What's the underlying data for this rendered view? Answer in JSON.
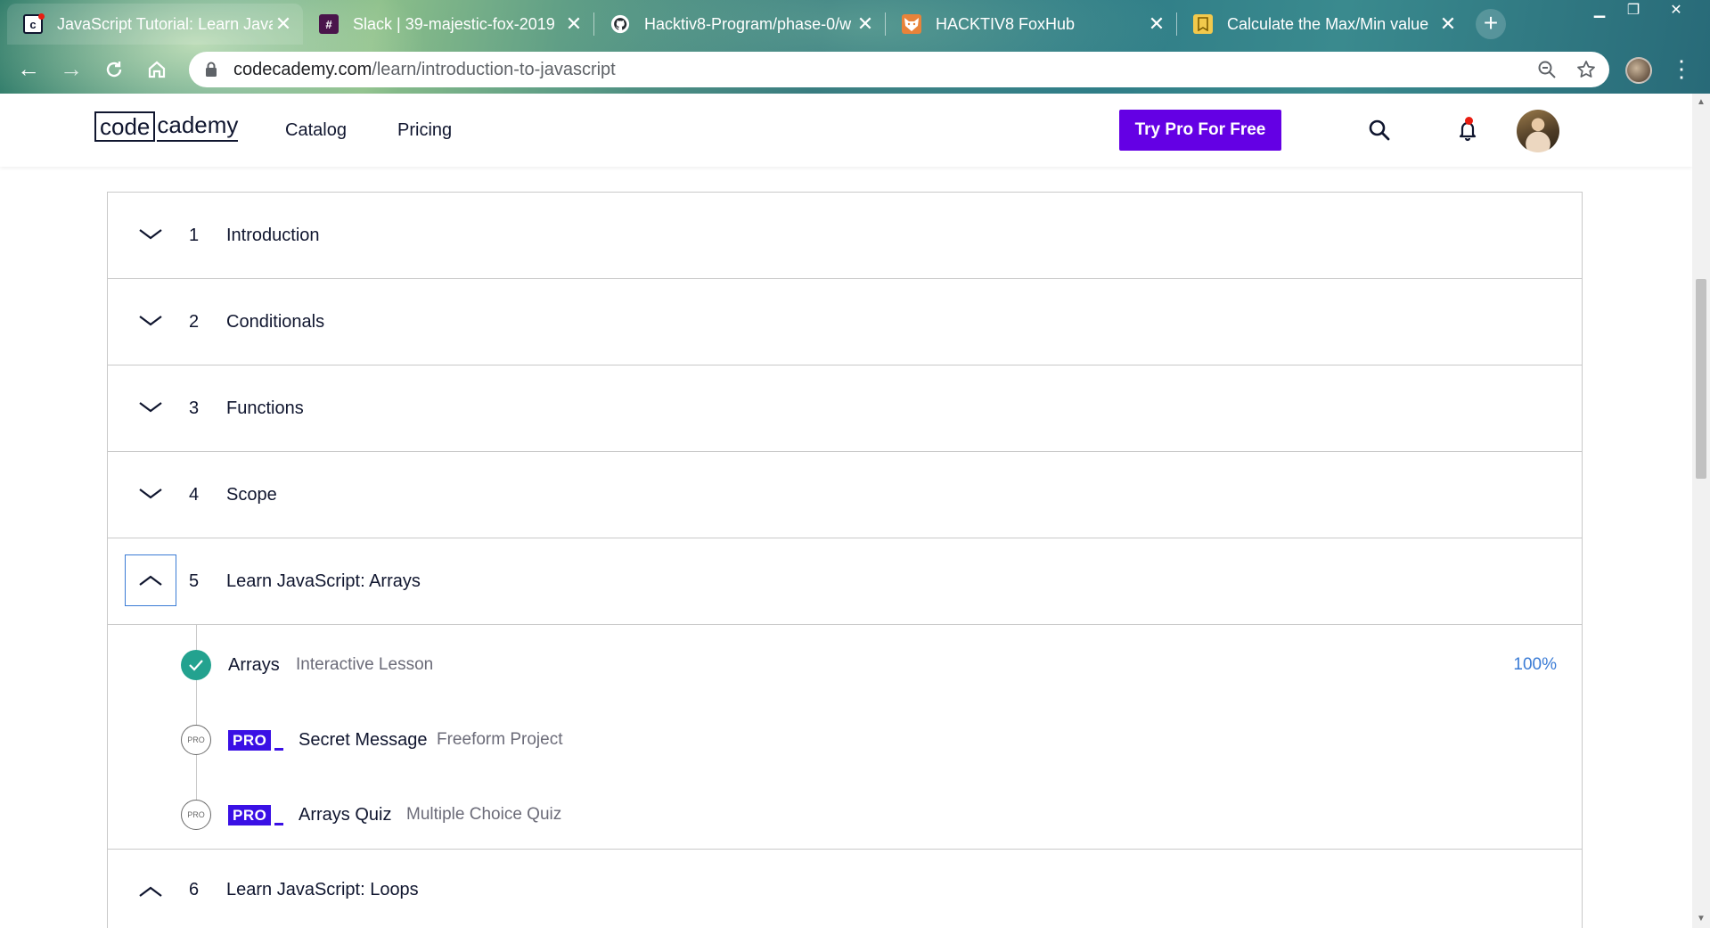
{
  "browser": {
    "tabs": [
      {
        "title": "JavaScript Tutorial: Learn JavaScript",
        "favicon": "codecademy-favicon",
        "active": true
      },
      {
        "title": "Slack | 39-majestic-fox-2019",
        "favicon": "slack-favicon",
        "active": false
      },
      {
        "title": "Hacktiv8-Program/phase-0/w",
        "favicon": "github-favicon",
        "active": false
      },
      {
        "title": "HACKTIV8 FoxHub",
        "favicon": "foxhub-favicon",
        "active": false
      },
      {
        "title": "Calculate the Max/Min value",
        "favicon": "bookmark-favicon",
        "active": false
      }
    ],
    "url_host": "codecademy.com",
    "url_path": "/learn/introduction-to-javascript"
  },
  "header": {
    "logo_box": "code",
    "logo_rest": "cademy",
    "nav": [
      "Catalog",
      "Pricing"
    ],
    "cta": "Try Pro For Free",
    "has_notification": true
  },
  "syllabus": {
    "modules": [
      {
        "num": "1",
        "title": "Introduction",
        "expanded": false
      },
      {
        "num": "2",
        "title": "Conditionals",
        "expanded": false
      },
      {
        "num": "3",
        "title": "Functions",
        "expanded": false
      },
      {
        "num": "4",
        "title": "Scope",
        "expanded": false
      },
      {
        "num": "5",
        "title": "Learn JavaScript: Arrays",
        "expanded": true
      },
      {
        "num": "6",
        "title": "Learn JavaScript: Loops",
        "expanded": true
      }
    ],
    "lessons": [
      {
        "name": "Arrays",
        "type": "Interactive Lesson",
        "status": "complete",
        "progress": "100%",
        "pro": false
      },
      {
        "name": "Secret Message",
        "type": "Freeform Project",
        "status": "pro-locked",
        "progress": "",
        "pro": true
      },
      {
        "name": "Arrays Quiz",
        "type": "Multiple Choice Quiz",
        "status": "pro-locked",
        "progress": "",
        "pro": true
      }
    ],
    "pro_label": "PRO",
    "pro_status_label": "PRO"
  },
  "colors": {
    "accent_purple": "#6400e4",
    "pro_badge": "#3a10e5",
    "complete_green": "#23a28f",
    "progress_blue": "#3a7bd5"
  }
}
